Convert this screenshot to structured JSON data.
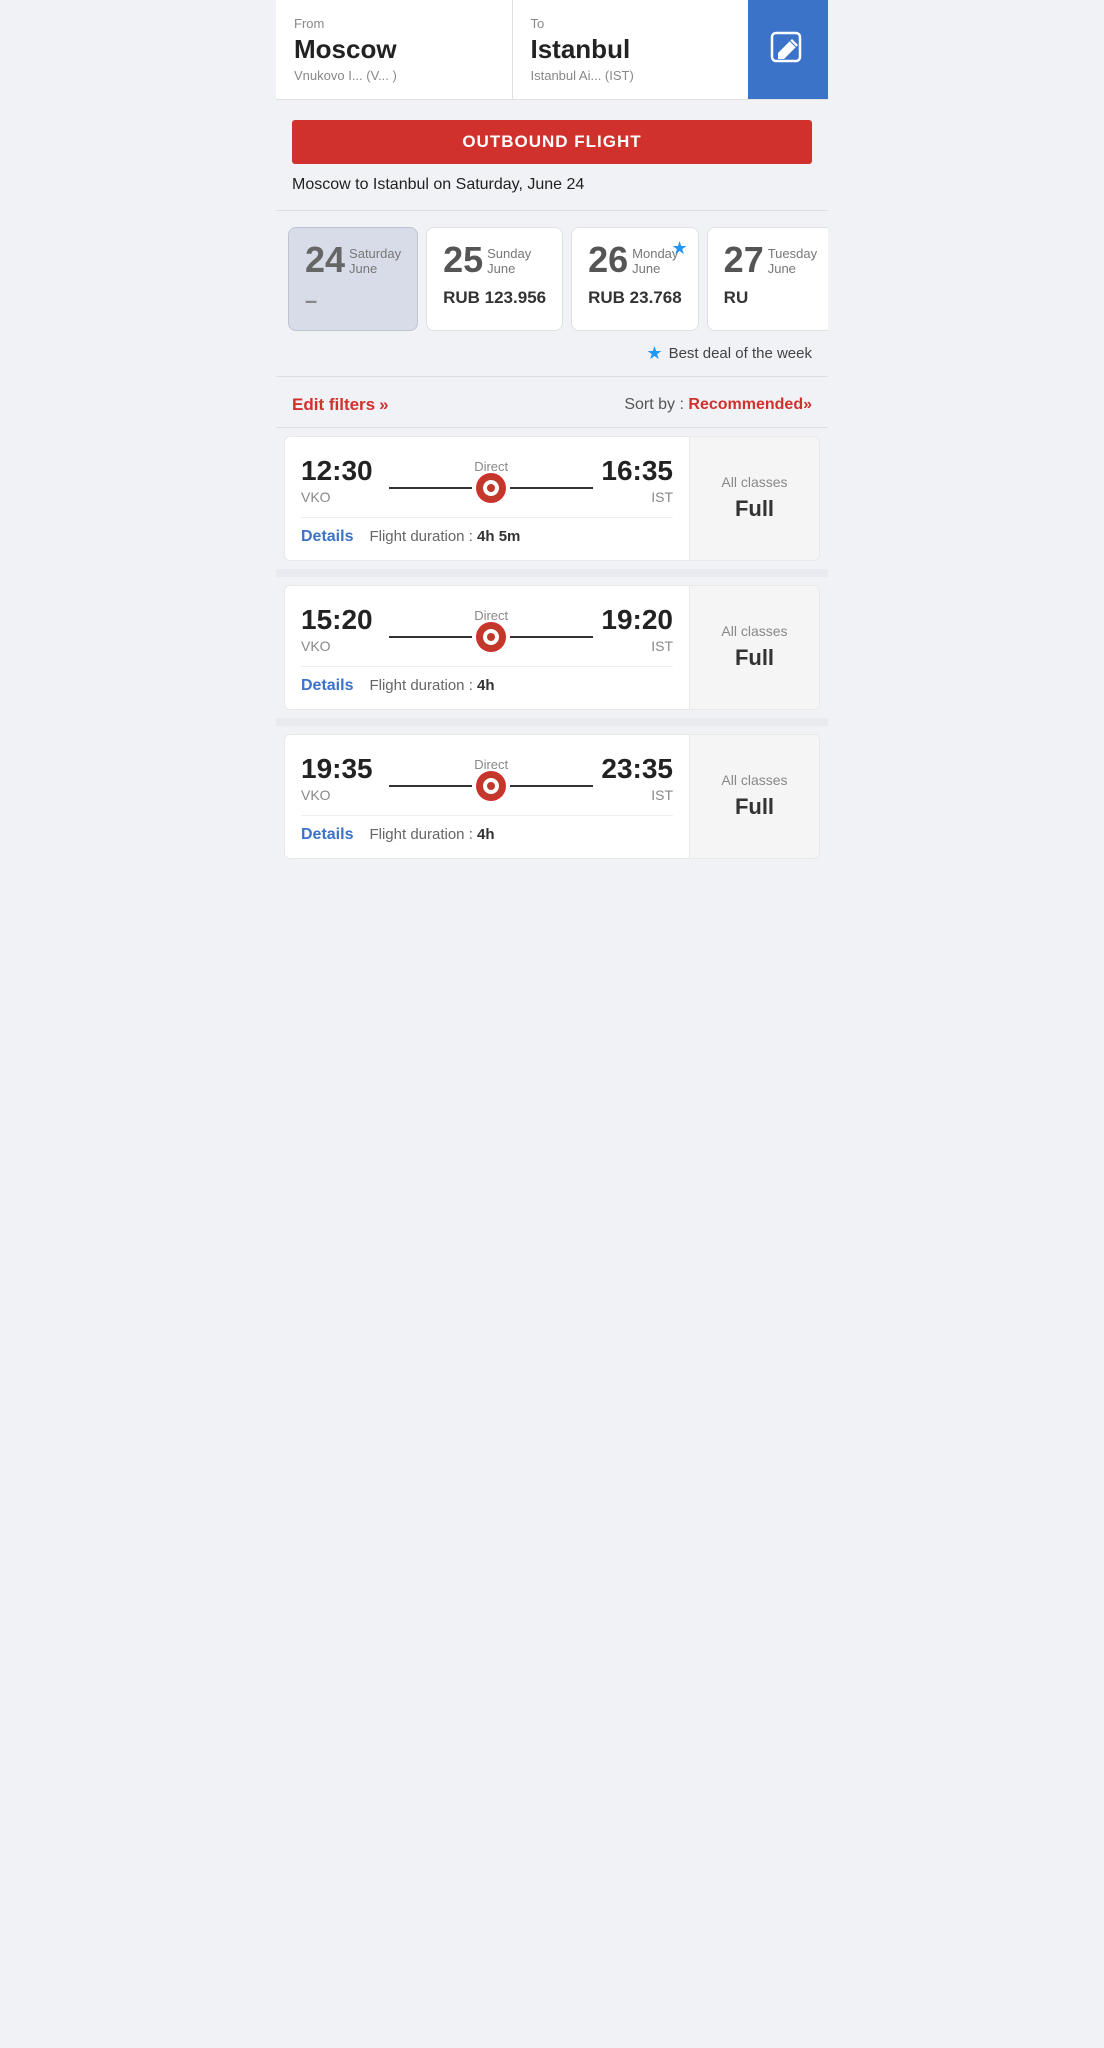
{
  "header": {
    "from_label": "From",
    "from_city": "Moscow",
    "from_airport": "Vnukovo I...  (V... )",
    "to_label": "To",
    "to_city": "Istanbul",
    "to_airport": "Istanbul Ai...  (IST)",
    "edit_icon": "edit-icon"
  },
  "outbound": {
    "banner_text": "OUTBOUND FLIGHT",
    "subtitle": "Moscow to Istanbul on Saturday, June 24"
  },
  "dates": [
    {
      "id": "date-24",
      "day": "24",
      "day_name": "Saturday",
      "month": "June",
      "price": null,
      "selected": true,
      "best_deal": false
    },
    {
      "id": "date-25",
      "day": "25",
      "day_name": "Sunday",
      "month": "June",
      "price": "RUB 123.956",
      "selected": false,
      "best_deal": false
    },
    {
      "id": "date-26",
      "day": "26",
      "day_name": "Monday",
      "month": "June",
      "price": "RUB 23.768",
      "selected": false,
      "best_deal": true
    },
    {
      "id": "date-27",
      "day": "27",
      "day_name": "Tuesday",
      "month": "June",
      "price": "RU",
      "selected": false,
      "best_deal": false
    }
  ],
  "best_deal_label": "Best deal of the week",
  "filters": {
    "edit_label": "Edit filters",
    "edit_arrows": "»",
    "sort_by_label": "Sort by : ",
    "sort_by_value": "Recommended",
    "sort_arrows": "»"
  },
  "flights": [
    {
      "depart_time": "12:30",
      "depart_airport": "VKO",
      "arrive_time": "16:35",
      "arrive_airport": "IST",
      "flight_type": "Direct",
      "duration_label": "Flight duration :",
      "duration_value": "4h 5m",
      "details_label": "Details",
      "fare_label": "All classes",
      "fare_status": "Full"
    },
    {
      "depart_time": "15:20",
      "depart_airport": "VKO",
      "arrive_time": "19:20",
      "arrive_airport": "IST",
      "flight_type": "Direct",
      "duration_label": "Flight duration :",
      "duration_value": "4h",
      "details_label": "Details",
      "fare_label": "All classes",
      "fare_status": "Full"
    },
    {
      "depart_time": "19:35",
      "depart_airport": "VKO",
      "arrive_time": "23:35",
      "arrive_airport": "IST",
      "flight_type": "Direct",
      "duration_label": "Flight duration :",
      "duration_value": "4h",
      "details_label": "Details",
      "fare_label": "All classes",
      "fare_status": "Full"
    }
  ]
}
